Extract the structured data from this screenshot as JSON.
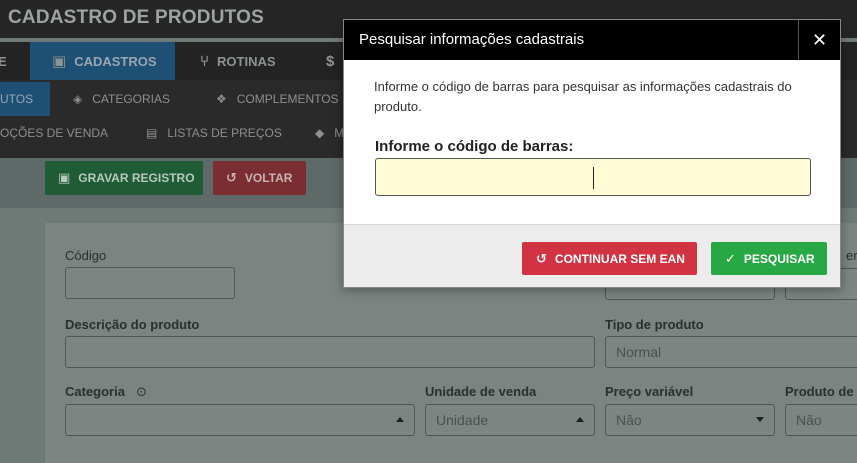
{
  "app": {
    "title": "CADASTRO DE PRODUTOS",
    "menu": [
      {
        "label": "E",
        "icon": "none"
      },
      {
        "label": "CADASTROS",
        "icon": "clipboard-icon"
      },
      {
        "label": "ROTINAS",
        "icon": "branch-icon"
      },
      {
        "label": "$",
        "icon": "money-icon"
      }
    ],
    "submenu": [
      {
        "label": "UTOS",
        "icon": "none"
      },
      {
        "label": "CATEGORIAS",
        "icon": "layers-icon"
      },
      {
        "label": "COMPLEMENTOS",
        "icon": "cubes-icon"
      },
      {
        "label": "OÇÕES DE VENDA",
        "icon": "none"
      },
      {
        "label": "LISTAS DE PREÇOS",
        "icon": "document-icon"
      },
      {
        "label": "M",
        "icon": "tags-icon"
      }
    ],
    "toolbar": {
      "save_label": "GRAVAR REGISTRO",
      "back_label": "VOLTAR"
    },
    "form": {
      "codigo_label": "Código",
      "descricao_label": "Descrição do produto",
      "tipo_label": "Tipo de produto",
      "tipo_value": "Normal",
      "categoria_label": "Categoria",
      "unidade_label": "Unidade de venda",
      "unidade_value": "Unidade",
      "preco_label": "Preço variável",
      "preco_value": "Não",
      "produto_label": "Produto de",
      "produto_value": "Não",
      "partial_label": "er"
    }
  },
  "modal": {
    "title": "Pesquisar informações cadastrais",
    "close_symbol": "✕",
    "description": "Informe o código de barras para pesquisar as informações cadastrais do produto.",
    "barcode_label": "Informe o código de barras:",
    "barcode_value": "",
    "continue_label": "CONTINUAR SEM EAN",
    "search_label": "PESQUISAR"
  },
  "colors": {
    "modal_header": "#000000",
    "input_background": "#fffbd6",
    "continue_button": "#d13343",
    "search_button": "#28a745",
    "active_menu": "#1e4f75"
  }
}
